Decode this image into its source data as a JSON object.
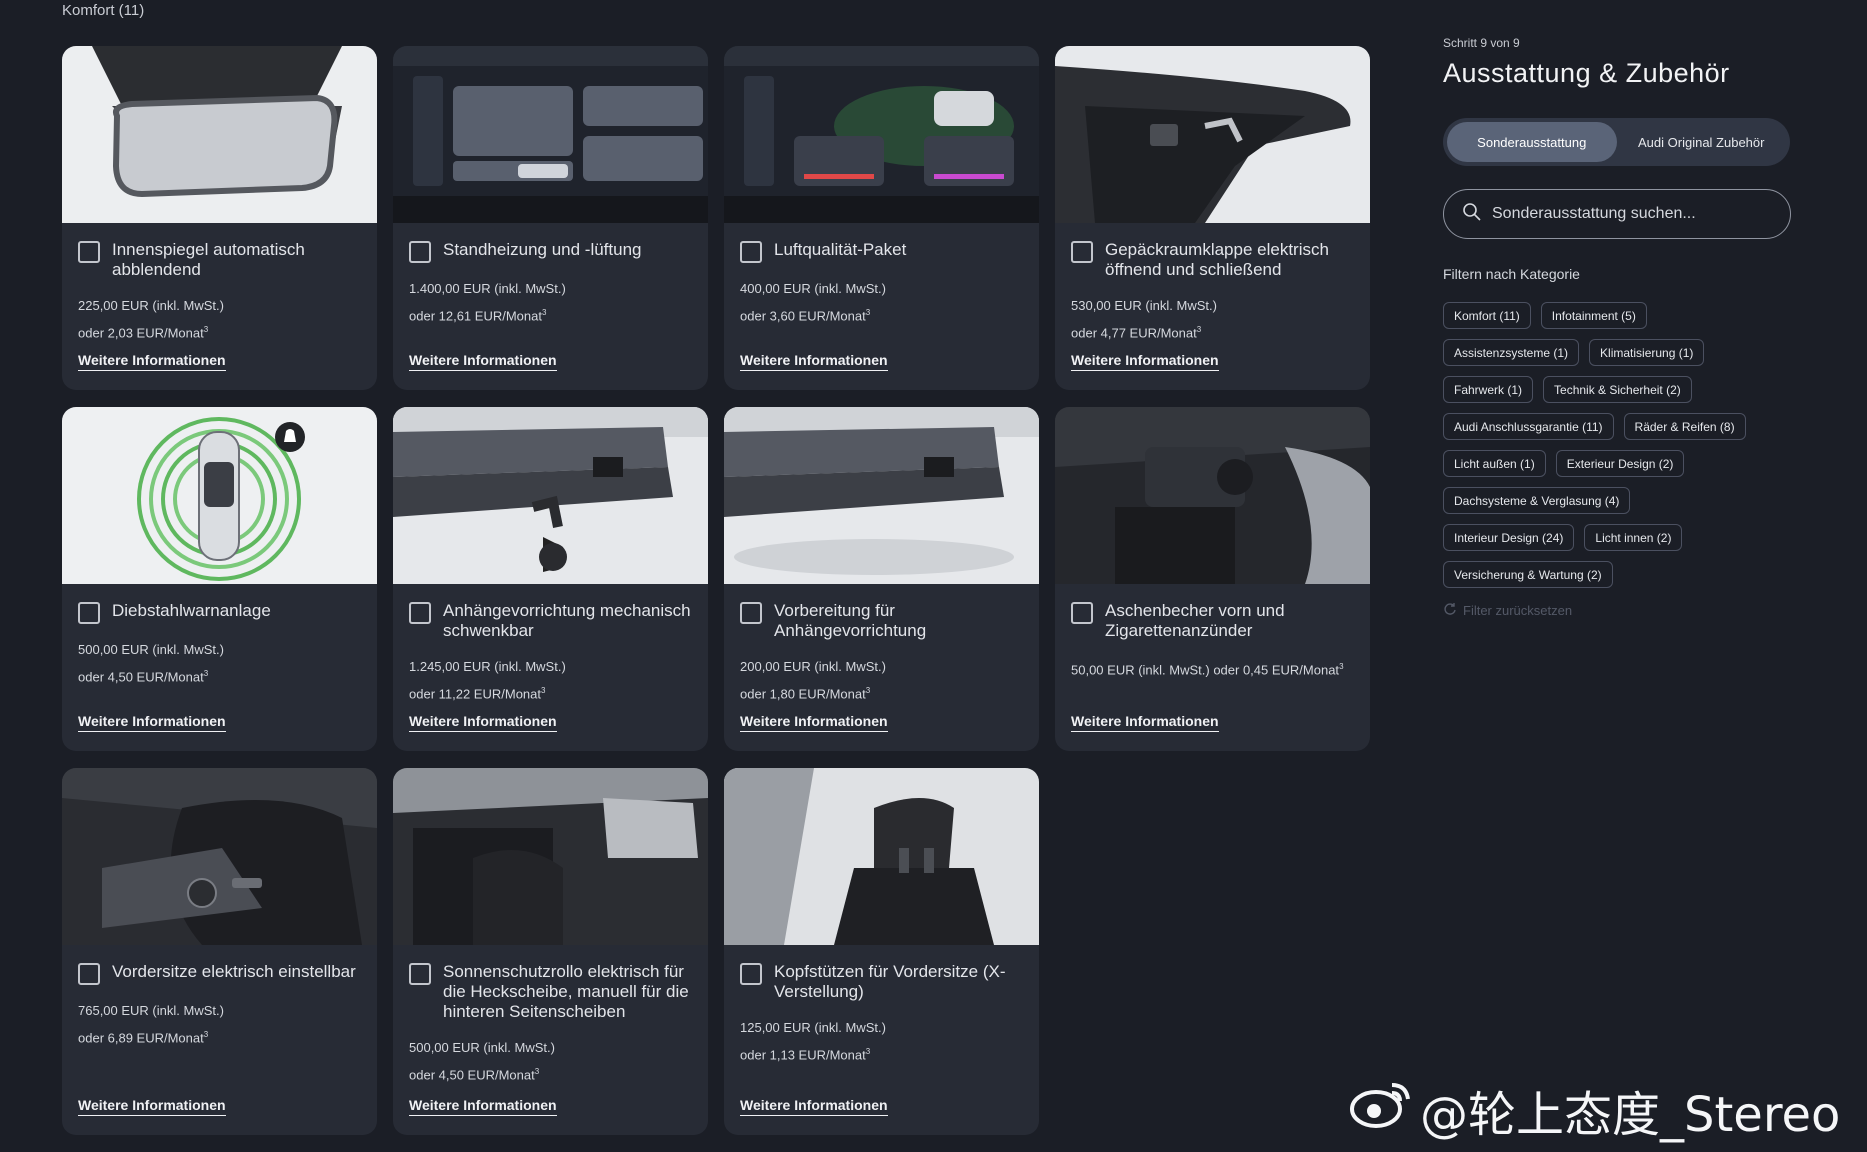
{
  "section_title": "Komfort (11)",
  "cards": [
    {
      "title": "Innenspiegel automatisch abblendend",
      "price": "225,00 EUR (inkl. MwSt.)",
      "monthly": "oder 2,03 EUR/Monat",
      "more": "Weitere Informationen"
    },
    {
      "title": "Standheizung und -lüftung",
      "price": "1.400,00 EUR (inkl. MwSt.)",
      "monthly": "oder 12,61 EUR/Monat",
      "more": "Weitere Informationen"
    },
    {
      "title": "Luftqualität-Paket",
      "price": "400,00 EUR (inkl. MwSt.)",
      "monthly": "oder 3,60 EUR/Monat",
      "more": "Weitere Informationen"
    },
    {
      "title": "Gepäckraumklappe elektrisch öffnend und schließend",
      "price": "530,00 EUR (inkl. MwSt.)",
      "monthly": "oder 4,77 EUR/Monat",
      "more": "Weitere Informationen"
    },
    {
      "title": "Diebstahlwarnanlage",
      "price": "500,00 EUR (inkl. MwSt.)",
      "monthly": "oder 4,50 EUR/Monat",
      "more": "Weitere Informationen"
    },
    {
      "title": "Anhängevorrichtung mechanisch schwenkbar",
      "price": "1.245,00 EUR (inkl. MwSt.)",
      "monthly": "oder 11,22 EUR/Monat",
      "more": "Weitere Informationen"
    },
    {
      "title": "Vorbereitung für Anhängevorrichtung",
      "price": "200,00 EUR (inkl. MwSt.)",
      "monthly": "oder 1,80 EUR/Monat",
      "more": "Weitere Informationen"
    },
    {
      "title": "Aschenbecher vorn und Zigarettenanzünder",
      "price": "50,00 EUR (inkl. MwSt.) oder 0,45 EUR/Monat",
      "monthly": "",
      "more": "Weitere Informationen"
    },
    {
      "title": "Vordersitze elektrisch einstellbar",
      "price": "765,00 EUR (inkl. MwSt.)",
      "monthly": "oder 6,89 EUR/Monat",
      "more": "Weitere Informationen"
    },
    {
      "title": "Sonnenschutzrollo elektrisch für die Heckscheibe, manuell für die hinteren Seitenscheiben",
      "price": "500,00 EUR (inkl. MwSt.)",
      "monthly": "oder 4,50 EUR/Monat",
      "more": "Weitere Informationen"
    },
    {
      "title": "Kopfstützen für Vordersitze (X-Verstellung)",
      "price": "125,00 EUR (inkl. MwSt.)",
      "monthly": "oder 1,13 EUR/Monat",
      "more": "Weitere Informationen"
    }
  ],
  "footnote_mark": "3",
  "panel": {
    "step": "Schritt 9 von 9",
    "title": "Ausstattung & Zubehör",
    "tabs": [
      "Sonderausstattung",
      "Audi Original Zubehör"
    ],
    "search_placeholder": "Sonderausstattung suchen...",
    "filter_heading": "Filtern nach Kategorie",
    "reset": "Filter zurücksetzen"
  },
  "chips": [
    [
      "Komfort (11)",
      "Infotainment (5)"
    ],
    [
      "Assistenzsysteme (1)",
      "Klimatisierung (1)"
    ],
    [
      "Fahrwerk (1)",
      "Technik & Sicherheit (2)"
    ],
    [
      "Audi Anschlussgarantie (11)",
      "Räder & Reifen (8)"
    ],
    [
      "Licht außen (1)",
      "Exterieur Design (2)"
    ],
    [
      "Dachsysteme & Verglasung (4)"
    ],
    [
      "Interieur Design (24)",
      "Licht innen (2)"
    ],
    [
      "Versicherung & Wartung (2)"
    ]
  ],
  "watermark": "@轮上态度_Stereo",
  "colors": {
    "background": "#1b1e26",
    "card": "#272b35",
    "toggle_active": "#5a6478"
  }
}
